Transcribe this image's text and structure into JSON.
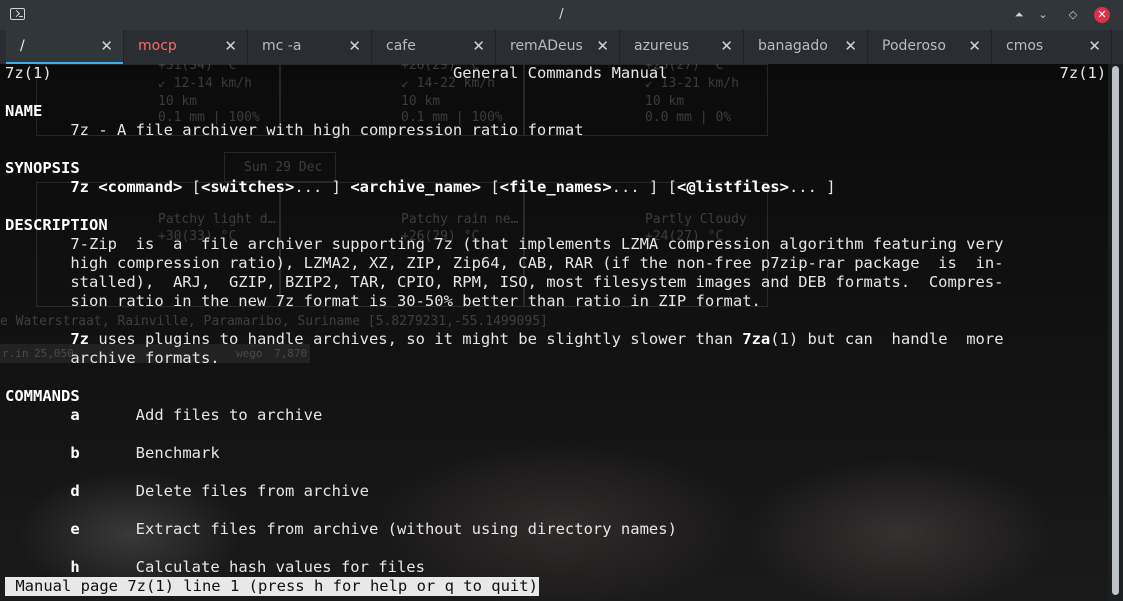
{
  "window": {
    "title": "/"
  },
  "tabs": [
    {
      "label": "/",
      "active": true
    },
    {
      "label": "mocp"
    },
    {
      "label": "mc -a"
    },
    {
      "label": "cafe"
    },
    {
      "label": "remADeus"
    },
    {
      "label": "azureus"
    },
    {
      "label": "banagado"
    },
    {
      "label": "Poderoso"
    },
    {
      "label": "cmos"
    }
  ],
  "tab_close_glyph": "✕",
  "man": {
    "header_left": "7z(1)",
    "header_center": "General Commands Manual",
    "header_right": "7z(1)",
    "sections": {
      "name": "NAME",
      "synopsis": "SYNOPSIS",
      "description": "DESCRIPTION",
      "commands": "COMMANDS"
    },
    "name_line": "7z - A file archiver with high compression ratio format",
    "synopsis": {
      "cmd": "7z",
      "command": "<command>",
      "switches": "<switches>",
      "archive_name": "<archive_name>",
      "file_names": "<file_names>",
      "listfiles": "<@listfiles>"
    },
    "description_lines": [
      "7-Zip  is  a  file archiver supporting 7z (that implements LZMA compression algorithm featuring very",
      "high compression ratio), LZMA2, XZ, ZIP, Zip64, CAB, RAR (if the non-free p7zip-rar package  is  in-",
      "stalled),  ARJ,  GZIP, BZIP2, TAR, CPIO, RPM, ISO, most filesystem images and DEB formats.  Compres-",
      "sion ratio in the new 7z format is 30-50% better than ratio in ZIP format."
    ],
    "plugins_line_a": "7z",
    "plugins_line_b": " uses plugins to handle archives, so it might be slightly slower than ",
    "plugins_line_c": "7za",
    "plugins_line_d": "(1) but can  handle  more",
    "plugins_line_2": "archive formats.",
    "commands": [
      {
        "key": "a",
        "desc": "Add files to archive"
      },
      {
        "key": "b",
        "desc": "Benchmark"
      },
      {
        "key": "d",
        "desc": "Delete files from archive"
      },
      {
        "key": "e",
        "desc": "Extract files from archive (without using directory names)"
      },
      {
        "key": "h",
        "desc": "Calculate hash values for files"
      }
    ],
    "status": " Manual page 7z(1) line 1 (press h for help or q to quit)"
  },
  "background": {
    "w1": "+31(34) °C",
    "w2": "↙ 12-14 km/h",
    "w3": "10 km",
    "w4": "0.1 mm | 100%",
    "w5": "+26(29) °C",
    "w6": "↙ 14-22 km/h",
    "w7": "10 km",
    "w8": "0.1 mm | 100%",
    "w9": "+25(27) °C",
    "w10": "↙ 13-21 km/h",
    "w11": "10 km",
    "w12": "0.0 mm | 0%",
    "date": "Sun 29 Dec",
    "c1": "Patchy light d…",
    "c2": "Patchy rain ne…",
    "c3": "Partly Cloudy",
    "t1": "+30(33) °C",
    "t2": "+26(29) °C",
    "t3": "+24(27) °C",
    "location": "e Waterstraat, Rainville, Paramaribo, Suriname [5.8279231,-55.1499095]",
    "stat_a": "r.in",
    "stat_b": "25,050",
    "stat_c": "wego",
    "stat_d": "7,870"
  },
  "colors": {
    "accent": "#3daee9",
    "close": "#d9324a",
    "alt_tab": "#ff6a6a"
  }
}
